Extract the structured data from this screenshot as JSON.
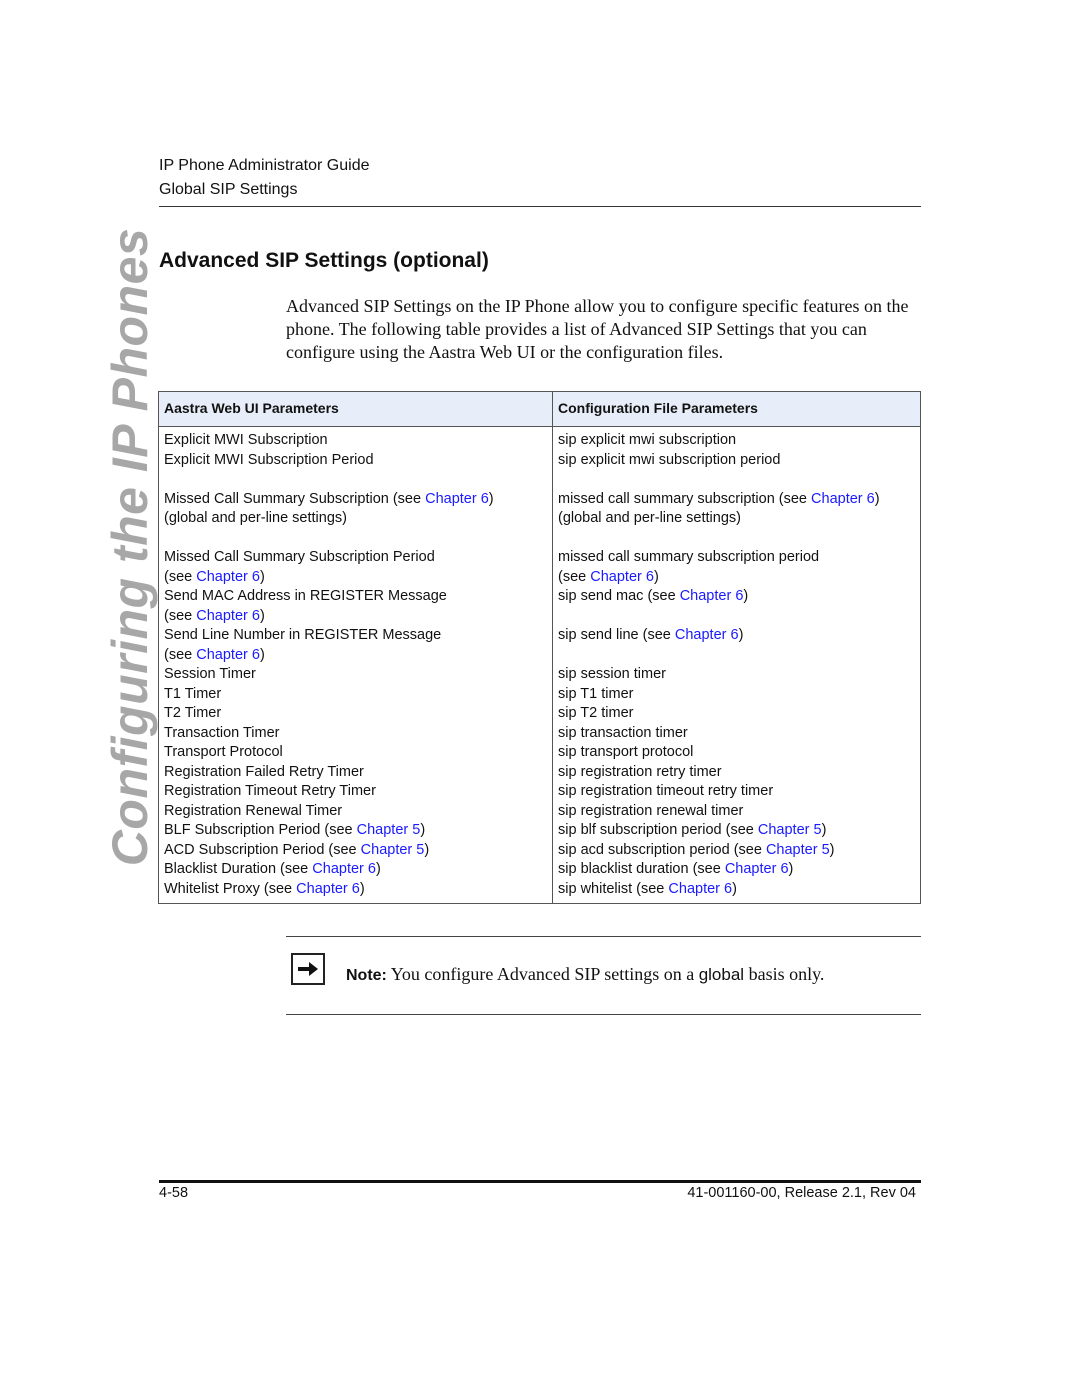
{
  "header": {
    "line1": "IP Phone Administrator Guide",
    "line2": "Global SIP Settings"
  },
  "side_title": "Configuring the IP Phones",
  "section": {
    "title": "Advanced SIP Settings (optional)",
    "intro": "Advanced SIP Settings on the IP Phone allow you to configure specific features on the phone. The following table provides a list of Advanced SIP Settings that you can configure using the Aastra Web UI or the configuration files."
  },
  "table": {
    "headers": [
      "Aastra Web UI Parameters",
      "Configuration File Parameters"
    ],
    "link_color": "#1a1aff",
    "header_bg": "#e8eef9",
    "rows": [
      {
        "web": [
          {
            "t": "Explicit MWI Subscription"
          }
        ],
        "file": [
          {
            "t": "sip explicit mwi subscription"
          }
        ]
      },
      {
        "web": [
          {
            "t": "Explicit MWI Subscription Period"
          }
        ],
        "file": [
          {
            "t": "sip explicit mwi subscription period"
          }
        ]
      },
      {
        "gap": true
      },
      {
        "web": [
          {
            "t": "Missed Call Summary Subscription (see "
          },
          {
            "t": "Chapter 6",
            "link": true
          },
          {
            "t": ")"
          }
        ],
        "file": [
          {
            "t": "missed call summary subscription (see "
          },
          {
            "t": "Chapter 6",
            "link": true
          },
          {
            "t": ")"
          }
        ]
      },
      {
        "web": [
          {
            "t": "(global and per-line settings)"
          }
        ],
        "file": [
          {
            "t": "(global and per-line settings)"
          }
        ]
      },
      {
        "gap": true
      },
      {
        "web": [
          {
            "t": "Missed Call Summary Subscription Period"
          }
        ],
        "file": [
          {
            "t": "missed call summary subscription period"
          }
        ]
      },
      {
        "web": [
          {
            "t": "(see "
          },
          {
            "t": "Chapter 6",
            "link": true
          },
          {
            "t": ")"
          }
        ],
        "file": [
          {
            "t": "(see "
          },
          {
            "t": "Chapter 6",
            "link": true
          },
          {
            "t": ")"
          }
        ]
      },
      {
        "web": [
          {
            "t": "Send MAC Address in REGISTER Message"
          }
        ],
        "file": [
          {
            "t": "sip send mac (see "
          },
          {
            "t": "Chapter 6",
            "link": true
          },
          {
            "t": ")"
          }
        ]
      },
      {
        "web": [
          {
            "t": "(see "
          },
          {
            "t": "Chapter 6",
            "link": true
          },
          {
            "t": ")"
          }
        ],
        "file": []
      },
      {
        "web": [
          {
            "t": "Send Line Number in REGISTER Message"
          }
        ],
        "file": [
          {
            "t": "sip send line (see "
          },
          {
            "t": "Chapter 6",
            "link": true
          },
          {
            "t": ")"
          }
        ]
      },
      {
        "web": [
          {
            "t": "(see "
          },
          {
            "t": "Chapter 6",
            "link": true
          },
          {
            "t": ")"
          }
        ],
        "file": []
      },
      {
        "web": [
          {
            "t": "Session Timer"
          }
        ],
        "file": [
          {
            "t": "sip session timer"
          }
        ]
      },
      {
        "web": [
          {
            "t": "T1 Timer"
          }
        ],
        "file": [
          {
            "t": "sip T1 timer"
          }
        ]
      },
      {
        "web": [
          {
            "t": "T2 Timer"
          }
        ],
        "file": [
          {
            "t": "sip T2 timer"
          }
        ]
      },
      {
        "web": [
          {
            "t": "Transaction Timer"
          }
        ],
        "file": [
          {
            "t": "sip transaction timer"
          }
        ]
      },
      {
        "web": [
          {
            "t": "Transport Protocol"
          }
        ],
        "file": [
          {
            "t": "sip transport protocol"
          }
        ]
      },
      {
        "web": [
          {
            "t": "Registration Failed Retry Timer"
          }
        ],
        "file": [
          {
            "t": "sip registration retry timer"
          }
        ]
      },
      {
        "web": [
          {
            "t": "Registration Timeout Retry Timer"
          }
        ],
        "file": [
          {
            "t": "sip registration timeout retry timer"
          }
        ]
      },
      {
        "web": [
          {
            "t": "Registration Renewal Timer"
          }
        ],
        "file": [
          {
            "t": "sip registration renewal timer"
          }
        ]
      },
      {
        "web": [
          {
            "t": "BLF Subscription Period (see "
          },
          {
            "t": "Chapter 5",
            "link": true
          },
          {
            "t": ")"
          }
        ],
        "file": [
          {
            "t": "sip blf subscription period (see "
          },
          {
            "t": "Chapter 5",
            "link": true
          },
          {
            "t": ")"
          }
        ]
      },
      {
        "web": [
          {
            "t": "ACD Subscription Period (see "
          },
          {
            "t": "Chapter 5",
            "link": true
          },
          {
            "t": ")"
          }
        ],
        "file": [
          {
            "t": "sip acd subscription period (see "
          },
          {
            "t": "Chapter 5",
            "link": true
          },
          {
            "t": ")"
          }
        ]
      },
      {
        "web": [
          {
            "t": "Blacklist Duration (see "
          },
          {
            "t": "Chapter 6",
            "link": true
          },
          {
            "t": ")"
          }
        ],
        "file": [
          {
            "t": "sip blacklist duration (see "
          },
          {
            "t": "Chapter 6",
            "link": true
          },
          {
            "t": ")"
          }
        ]
      },
      {
        "web": [
          {
            "t": "Whitelist Proxy (see "
          },
          {
            "t": "Chapter 6",
            "link": true
          },
          {
            "t": ")"
          }
        ],
        "file": [
          {
            "t": "sip whitelist (see "
          },
          {
            "t": "Chapter 6",
            "link": true
          },
          {
            "t": ")"
          }
        ]
      }
    ]
  },
  "note": {
    "icon": "arrow-right-icon",
    "label": "Note:",
    "text_before": " You configure Advanced SIP settings on a ",
    "emphasis": "global",
    "text_after": " basis only."
  },
  "footer": {
    "page_number": "4-58",
    "doc_id": "41-001160-00, Release 2.1, Rev 04"
  }
}
